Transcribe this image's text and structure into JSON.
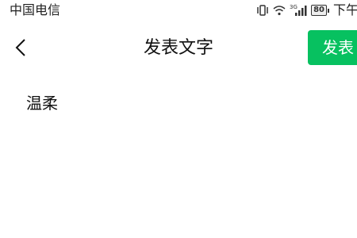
{
  "status_bar": {
    "carrier": "中国电信",
    "network_label": "3G",
    "battery_level": "80",
    "time": "下午"
  },
  "icons": {
    "back": "chevron-left-icon",
    "vibrate": "vibrate-icon",
    "wifi": "wifi-icon",
    "signal": "signal-icon",
    "battery": "battery-icon"
  },
  "header": {
    "title": "发表文字",
    "publish_label": "发表"
  },
  "content": {
    "text": "温柔"
  },
  "colors": {
    "accent": "#07c160",
    "text": "#111111",
    "background": "#ffffff"
  }
}
